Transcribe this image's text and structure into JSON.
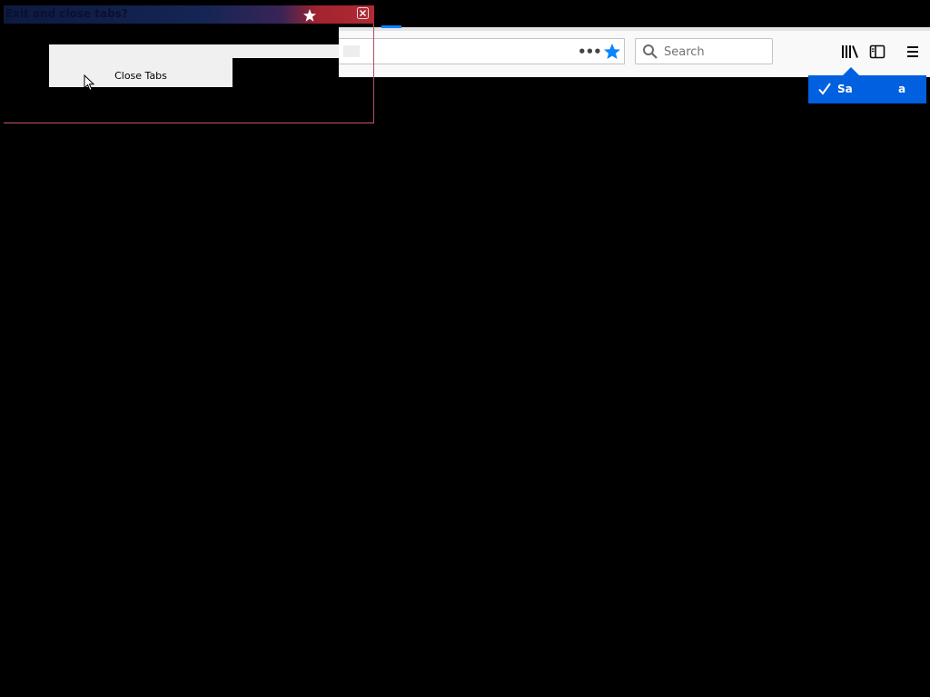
{
  "dialog": {
    "title": "Exit and close tabs?",
    "close_tabs_label": "Close Tabs"
  },
  "toolbar": {
    "page_actions_label": "•••",
    "search_placeholder": "Search"
  },
  "bookmark_popup": {
    "text_left": "Sa",
    "text_right": "a"
  },
  "icons": {
    "page_actions": "more-icon",
    "bookmark": "star-icon",
    "search": "search-icon",
    "library": "library-icon",
    "sidebar": "sidebar-icon",
    "menu": "hamburger-menu-icon",
    "dialog_close": "close-icon",
    "saved": "checkmark-icon",
    "cursor": "mouse-pointer-icon"
  },
  "colors": {
    "accent": "#0a84ff",
    "popup": "#0060df",
    "background": "#000000"
  }
}
